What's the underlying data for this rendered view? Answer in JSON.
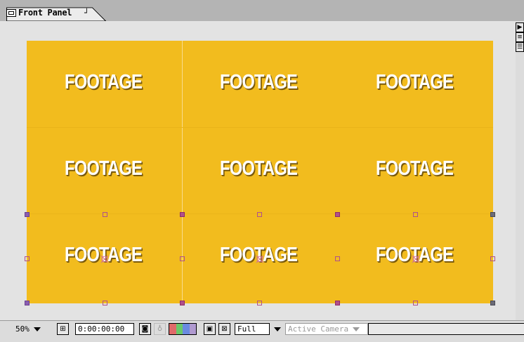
{
  "window": {
    "tab_label": "Front Panel",
    "tab_menu_glyph": "┘",
    "tab_icon": "composition-icon"
  },
  "side_buttons": [
    {
      "icon": "expand-arrow-icon",
      "glyph": "▶"
    },
    {
      "icon": "list-icon",
      "glyph": "≡"
    },
    {
      "icon": "flowchart-icon",
      "glyph": "☰"
    }
  ],
  "composition": {
    "background_color": "#f2bc1e",
    "tile_label": "FOOTAGE",
    "tiles": [
      {
        "label": "FOOTAGE"
      },
      {
        "label": "FOOTAGE"
      },
      {
        "label": "FOOTAGE"
      },
      {
        "label": "FOOTAGE"
      },
      {
        "label": "FOOTAGE"
      },
      {
        "label": "FOOTAGE"
      },
      {
        "label": "FOOTAGE"
      },
      {
        "label": "FOOTAGE"
      },
      {
        "label": "FOOTAGE"
      }
    ]
  },
  "statusbar": {
    "zoom": "50%",
    "safe_zones_icon": "title-action-safe-icon",
    "timecode": "0:00:00:00",
    "snapshot_icon": "camera-icon",
    "show_snapshot_icon": "person-icon",
    "channels": [
      "#e06a6a",
      "#6ac86a",
      "#6a8ae0",
      "#b09ad0"
    ],
    "region_icon": "region-of-interest-icon",
    "transparency_icon": "transparency-grid-icon",
    "resolution": "Full",
    "camera": "Active Camera"
  }
}
